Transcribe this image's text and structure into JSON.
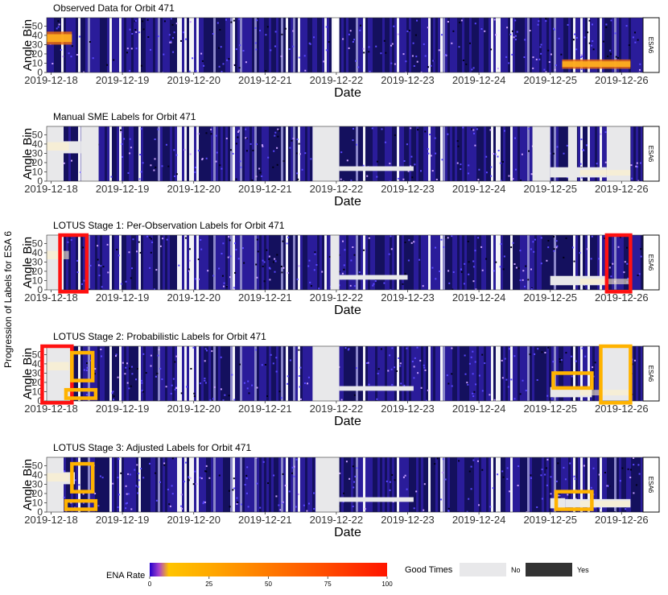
{
  "figure": {
    "side_label": "Progression of Labels for ESA 6"
  },
  "chart_data": [
    {
      "type": "heatmap",
      "title": "Observed Data for Orbit 471",
      "strip_label": "ESA6",
      "xlabel": "Date",
      "ylabel": "Angle Bin",
      "x_ticks": [
        "2019-12-18",
        "2019-12-19",
        "2019-12-20",
        "2019-12-21",
        "2019-12-22",
        "2019-12-23",
        "2019-12-24",
        "2019-12-25",
        "2019-12-26"
      ],
      "y_ticks": [
        0,
        10,
        20,
        30,
        40,
        50
      ],
      "xlim": [
        "2019-12-18",
        "2019-12-26"
      ],
      "ylim": [
        0,
        59
      ],
      "mode": "observed",
      "bright_bands": [
        {
          "x": [
            "2019-12-17T21:00",
            "2019-12-18T07:00"
          ],
          "y": [
            30,
            44
          ]
        },
        {
          "x": [
            "2019-12-25T04:00",
            "2019-12-26T03:00"
          ],
          "y": [
            4,
            14
          ]
        }
      ],
      "data_gaps": [
        [
          "2019-12-21T23:00",
          "2019-12-22T01:00"
        ]
      ],
      "highlight_boxes": []
    },
    {
      "type": "heatmap",
      "title": "Manual SME Labels for Orbit 471",
      "strip_label": "ESA6",
      "xlabel": "Date",
      "ylabel": "Angle Bin",
      "x_ticks": [
        "2019-12-18",
        "2019-12-19",
        "2019-12-20",
        "2019-12-21",
        "2019-12-22",
        "2019-12-23",
        "2019-12-24",
        "2019-12-25",
        "2019-12-26"
      ],
      "y_ticks": [
        0,
        10,
        20,
        30,
        40,
        50
      ],
      "xlim": [
        "2019-12-18",
        "2019-12-26"
      ],
      "ylim": [
        0,
        59
      ],
      "mode": "labels",
      "bad_full": [
        [
          "2019-12-17T21:00",
          "2019-12-18T04:00"
        ],
        [
          "2019-12-18T10:00",
          "2019-12-18T16:00"
        ],
        [
          "2019-12-21T16:00",
          "2019-12-22T01:00"
        ],
        [
          "2019-12-24T18:00",
          "2019-12-25T00:00"
        ],
        [
          "2019-12-25T06:00",
          "2019-12-25T09:00"
        ],
        [
          "2019-12-25T19:00",
          "2019-12-26T03:00"
        ]
      ],
      "bad_partial": [
        {
          "x": [
            "2019-12-18T04:00",
            "2019-12-18T10:00"
          ],
          "y": [
            30,
            43
          ]
        },
        {
          "x": [
            "2019-12-22T01:00",
            "2019-12-23T02:00"
          ],
          "y": [
            11,
            16
          ]
        },
        {
          "x": [
            "2019-12-25T00:00",
            "2019-12-25T19:00"
          ],
          "y": [
            4,
            15
          ]
        }
      ],
      "highlight_boxes": []
    },
    {
      "type": "heatmap",
      "title": "LOTUS Stage 1: Per-Observation Labels for Orbit 471",
      "strip_label": "ESA6",
      "xlabel": "Date",
      "ylabel": "Angle Bin",
      "x_ticks": [
        "2019-12-18",
        "2019-12-19",
        "2019-12-20",
        "2019-12-21",
        "2019-12-22",
        "2019-12-23",
        "2019-12-24",
        "2019-12-25",
        "2019-12-26"
      ],
      "y_ticks": [
        0,
        10,
        20,
        30,
        40,
        50
      ],
      "xlim": [
        "2019-12-18",
        "2019-12-26"
      ],
      "ylim": [
        0,
        59
      ],
      "mode": "labels",
      "bad_full": [
        [
          "2019-12-17T21:00",
          "2019-12-18T03:00"
        ],
        [
          "2019-12-21T22:00",
          "2019-12-22T01:00"
        ]
      ],
      "bad_partial": [
        {
          "x": [
            "2019-12-22T01:00",
            "2019-12-23T00:00"
          ],
          "y": [
            11,
            16
          ]
        },
        {
          "x": [
            "2019-12-25T00:00",
            "2019-12-25T19:00"
          ],
          "y": [
            5,
            15
          ]
        }
      ],
      "highlight_boxes": [
        {
          "color": "#ff1111",
          "x": [
            "2019-12-18T03:00",
            "2019-12-18T12:00"
          ],
          "y": [
            -2,
            59
          ]
        },
        {
          "color": "#ff1111",
          "x": [
            "2019-12-25T19:00",
            "2019-12-26T03:00"
          ],
          "y": [
            -2,
            59
          ]
        }
      ]
    },
    {
      "type": "heatmap",
      "title": "LOTUS Stage 2: Probabilistic Labels for Orbit 471",
      "strip_label": "ESA6",
      "xlabel": "Date",
      "ylabel": "Angle Bin",
      "x_ticks": [
        "2019-12-18",
        "2019-12-19",
        "2019-12-20",
        "2019-12-21",
        "2019-12-22",
        "2019-12-23",
        "2019-12-24",
        "2019-12-25",
        "2019-12-26"
      ],
      "y_ticks": [
        0,
        10,
        20,
        30,
        40,
        50
      ],
      "xlim": [
        "2019-12-18",
        "2019-12-26"
      ],
      "ylim": [
        0,
        59
      ],
      "mode": "labels",
      "bad_full": [
        [
          "2019-12-17T21:00",
          "2019-12-18T07:00"
        ],
        [
          "2019-12-21T16:00",
          "2019-12-22T01:00"
        ],
        [
          "2019-12-25T17:00",
          "2019-12-26T03:00"
        ]
      ],
      "bad_partial": [
        {
          "x": [
            "2019-12-22T01:00",
            "2019-12-23T02:00"
          ],
          "y": [
            11,
            16
          ]
        },
        {
          "x": [
            "2019-12-25T00:00",
            "2019-12-25T14:00"
          ],
          "y": [
            4,
            15
          ]
        }
      ],
      "highlight_boxes": [
        {
          "color": "#ff1111",
          "x": [
            "2019-12-17T21:00",
            "2019-12-18T07:00"
          ],
          "y": [
            -2,
            59
          ]
        },
        {
          "color": "#ffb300",
          "x": [
            "2019-12-18T07:00",
            "2019-12-18T14:00"
          ],
          "y": [
            22,
            52
          ]
        },
        {
          "color": "#ffb300",
          "x": [
            "2019-12-18T05:00",
            "2019-12-18T15:00"
          ],
          "y": [
            3,
            12
          ]
        },
        {
          "color": "#ffb300",
          "x": [
            "2019-12-25T01:00",
            "2019-12-25T14:00"
          ],
          "y": [
            14,
            30
          ]
        },
        {
          "color": "#ffb300",
          "x": [
            "2019-12-25T17:00",
            "2019-12-26T03:00"
          ],
          "y": [
            -2,
            59
          ]
        }
      ]
    },
    {
      "type": "heatmap",
      "title": "LOTUS Stage 3: Adjusted Labels for Orbit 471",
      "strip_label": "ESA6",
      "xlabel": "Date",
      "ylabel": "Angle Bin",
      "x_ticks": [
        "2019-12-18",
        "2019-12-19",
        "2019-12-20",
        "2019-12-21",
        "2019-12-22",
        "2019-12-23",
        "2019-12-24",
        "2019-12-25",
        "2019-12-26"
      ],
      "y_ticks": [
        0,
        10,
        20,
        30,
        40,
        50
      ],
      "xlim": [
        "2019-12-18",
        "2019-12-26"
      ],
      "ylim": [
        0,
        59
      ],
      "mode": "labels",
      "bad_full": [
        [
          "2019-12-17T21:00",
          "2019-12-18T04:00"
        ],
        [
          "2019-12-21T17:00",
          "2019-12-22T01:00"
        ]
      ],
      "bad_partial": [
        {
          "x": [
            "2019-12-18T04:00",
            "2019-12-18T08:00"
          ],
          "y": [
            30,
            43
          ]
        },
        {
          "x": [
            "2019-12-22T01:00",
            "2019-12-23T02:00"
          ],
          "y": [
            11,
            16
          ]
        },
        {
          "x": [
            "2019-12-25T00:00",
            "2019-12-25T05:00"
          ],
          "y": [
            4,
            15
          ]
        },
        {
          "x": [
            "2019-12-25T05:00",
            "2019-12-26T03:00"
          ],
          "y": [
            5,
            14
          ]
        }
      ],
      "highlight_boxes": [
        {
          "color": "#ffb300",
          "x": [
            "2019-12-18T07:00",
            "2019-12-18T14:00"
          ],
          "y": [
            22,
            52
          ]
        },
        {
          "color": "#ffb300",
          "x": [
            "2019-12-18T05:00",
            "2019-12-18T15:00"
          ],
          "y": [
            3,
            12
          ]
        },
        {
          "color": "#ffb300",
          "x": [
            "2019-12-25T02:00",
            "2019-12-25T14:00"
          ],
          "y": [
            3,
            22
          ]
        }
      ]
    }
  ],
  "legend": {
    "colorbar": {
      "title": "ENA Rate",
      "ticks": [
        0,
        25,
        50,
        75,
        100
      ],
      "colors": [
        "#2200cc",
        "#ffaa00",
        "#ff7700",
        "#ff4400",
        "#ff1500"
      ]
    },
    "good_times": {
      "title": "Good Times",
      "items": [
        {
          "label": "No",
          "color": "#e8e8ea"
        },
        {
          "label": "Yes",
          "color": "#333333"
        }
      ]
    }
  }
}
